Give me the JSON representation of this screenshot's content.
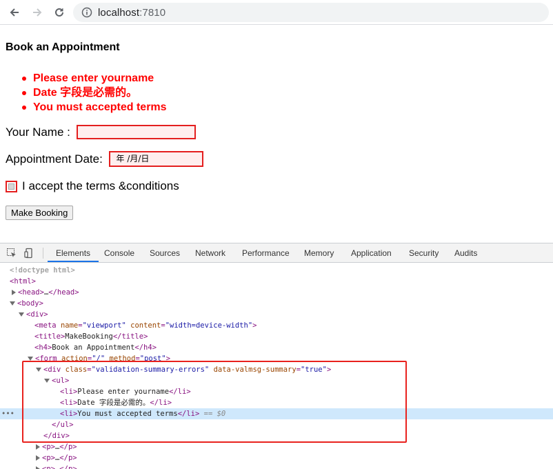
{
  "browser": {
    "url_host": "localhost",
    "url_port": ":7810"
  },
  "page": {
    "heading": "Book an Appointment",
    "errors": [
      "Please enter yourname",
      "Date 字段是必需的。",
      "You must accepted terms"
    ],
    "name_label": "Your Name : ",
    "name_value": "",
    "date_label": "Appointment Date: ",
    "date_placeholder": "年 /月/日",
    "terms_label": "I accept the terms &conditions",
    "terms_checked": false,
    "submit_label": "Make Booking",
    "error_color": "#ff0000"
  },
  "devtools": {
    "tabs": [
      "Elements",
      "Console",
      "Sources",
      "Network",
      "Performance",
      "Memory",
      "Application",
      "Security",
      "Audits"
    ],
    "active_tab": "Elements",
    "lines": {
      "doctype": "<!doctype html>",
      "html": "html",
      "head_open": "head",
      "head_ellipsis": "…",
      "head_close": "</head>",
      "body": "body",
      "div": "div",
      "meta_tag": "meta",
      "meta_name_attr": "name",
      "meta_name_val": "\"viewport\"",
      "meta_content_attr": "content",
      "meta_content_val": "\"width=device-width\"",
      "title_text": "MakeBooking",
      "h4_text": "Book an Appointment",
      "form_action_attr": "action",
      "form_action_val": "\"/\"",
      "form_method_attr": "method",
      "form_method_val": "\"post\"",
      "vdiv_class_attr": "class",
      "vdiv_class_val": "\"validation-summary-errors\"",
      "vdiv_data_attr": "data-valmsg-summary",
      "vdiv_data_val": "\"true\"",
      "li1": "Please enter yourname",
      "li2": "Date 字段是必需的。",
      "li3": "You must accepted terms",
      "eq_marker": "== $0",
      "p_ellipsis": "…"
    },
    "highlight_color": "#e8211d"
  }
}
